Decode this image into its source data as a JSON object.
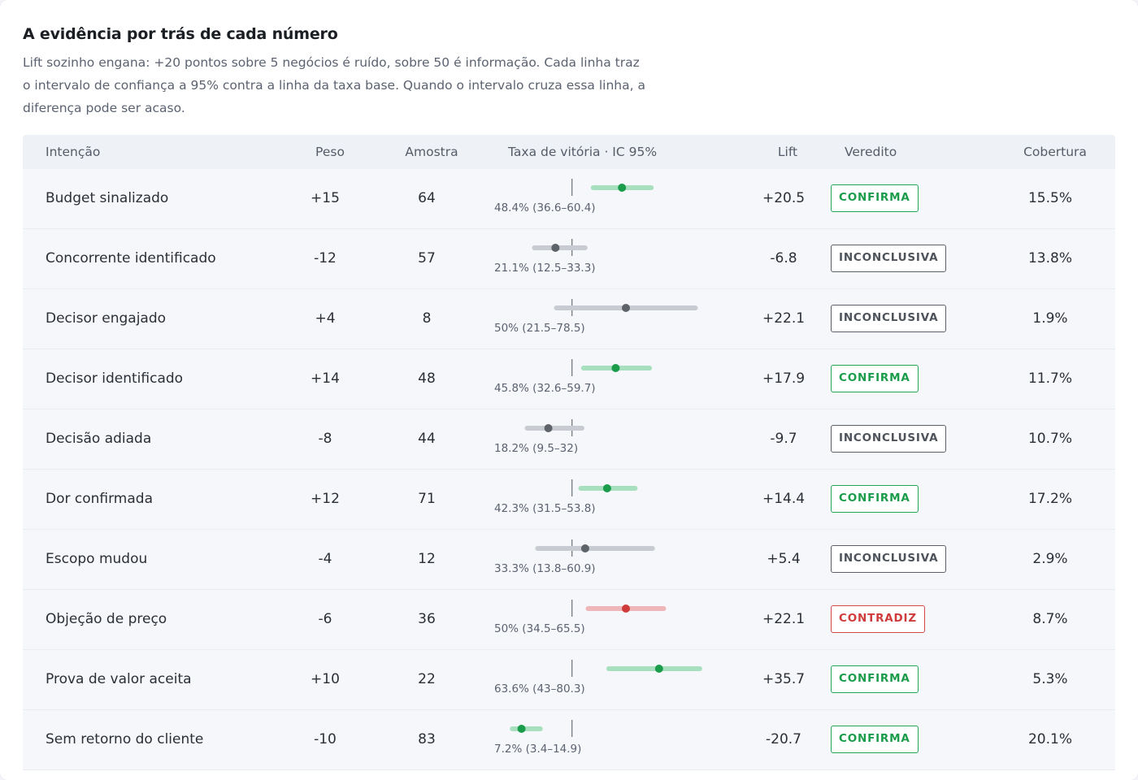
{
  "section": {
    "title": "A evidência por trás de cada número",
    "description": "Lift sozinho engana: +20 pontos sobre 5 negócios é ruído, sobre 50 é informação. Cada linha traz o intervalo de confiança a 95% contra a linha da taxa base. Quando o intervalo cruza essa linha, a diferença pode ser acaso."
  },
  "colors": {
    "confirma": "#1a9c4b",
    "confirma_bar": "#a8dfbf",
    "inconclusiva": "#4d525b",
    "inconclusiva_bar": "#c8cbd1",
    "inconclusiva_dot": "#5e6269",
    "contradiz": "#cf3b3b",
    "contradiz_bar": "#eeb6b9",
    "baseline": "#6b7078"
  },
  "table": {
    "headers": {
      "intent": "Intenção",
      "weight": "Peso",
      "sample": "Amostra",
      "win_rate": "Taxa de vitória · IC 95%",
      "lift": "Lift",
      "verdict": "Veredito",
      "coverage": "Cobertura"
    },
    "baseline_rate": 27.9,
    "rows": [
      {
        "name": "Budget sinalizado",
        "weight": "+15",
        "sample": "64",
        "rate": 48.4,
        "lo": 36.6,
        "hi": 60.4,
        "rate_label": "48.4% (36.6–60.4)",
        "lift": "+20.5",
        "verdict": "CONFIRMA",
        "verdict_class": "confirma",
        "coverage": "15.5%"
      },
      {
        "name": "Concorrente identificado",
        "weight": "-12",
        "sample": "57",
        "rate": 21.1,
        "lo": 12.5,
        "hi": 33.3,
        "rate_label": "21.1% (12.5–33.3)",
        "lift": "-6.8",
        "verdict": "INCONCLUSIVA",
        "verdict_class": "inconclusiva",
        "coverage": "13.8%"
      },
      {
        "name": "Decisor engajado",
        "weight": "+4",
        "sample": "8",
        "rate": 50,
        "lo": 21.5,
        "hi": 78.5,
        "rate_label": "50% (21.5–78.5)",
        "lift": "+22.1",
        "verdict": "INCONCLUSIVA",
        "verdict_class": "inconclusiva",
        "coverage": "1.9%"
      },
      {
        "name": "Decisor identificado",
        "weight": "+14",
        "sample": "48",
        "rate": 45.8,
        "lo": 32.6,
        "hi": 59.7,
        "rate_label": "45.8% (32.6–59.7)",
        "lift": "+17.9",
        "verdict": "CONFIRMA",
        "verdict_class": "confirma",
        "coverage": "11.7%"
      },
      {
        "name": "Decisão adiada",
        "weight": "-8",
        "sample": "44",
        "rate": 18.2,
        "lo": 9.5,
        "hi": 32,
        "rate_label": "18.2% (9.5–32)",
        "lift": "-9.7",
        "verdict": "INCONCLUSIVA",
        "verdict_class": "inconclusiva",
        "coverage": "10.7%"
      },
      {
        "name": "Dor confirmada",
        "weight": "+12",
        "sample": "71",
        "rate": 42.3,
        "lo": 31.5,
        "hi": 53.8,
        "rate_label": "42.3% (31.5–53.8)",
        "lift": "+14.4",
        "verdict": "CONFIRMA",
        "verdict_class": "confirma",
        "coverage": "17.2%"
      },
      {
        "name": "Escopo mudou",
        "weight": "-4",
        "sample": "12",
        "rate": 33.3,
        "lo": 13.8,
        "hi": 60.9,
        "rate_label": "33.3% (13.8–60.9)",
        "lift": "+5.4",
        "verdict": "INCONCLUSIVA",
        "verdict_class": "inconclusiva",
        "coverage": "2.9%"
      },
      {
        "name": "Objeção de preço",
        "weight": "-6",
        "sample": "36",
        "rate": 50,
        "lo": 34.5,
        "hi": 65.5,
        "rate_label": "50% (34.5–65.5)",
        "lift": "+22.1",
        "verdict": "CONTRADIZ",
        "verdict_class": "contradiz",
        "coverage": "8.7%"
      },
      {
        "name": "Prova de valor aceita",
        "weight": "+10",
        "sample": "22",
        "rate": 63.6,
        "lo": 43,
        "hi": 80.3,
        "rate_label": "63.6% (43–80.3)",
        "lift": "+35.7",
        "verdict": "CONFIRMA",
        "verdict_class": "confirma",
        "coverage": "5.3%"
      },
      {
        "name": "Sem retorno do cliente",
        "weight": "-10",
        "sample": "83",
        "rate": 7.2,
        "lo": 3.4,
        "hi": 14.9,
        "rate_label": "7.2% (3.4–14.9)",
        "lift": "-20.7",
        "verdict": "CONFIRMA",
        "verdict_class": "confirma",
        "coverage": "20.1%"
      }
    ]
  }
}
